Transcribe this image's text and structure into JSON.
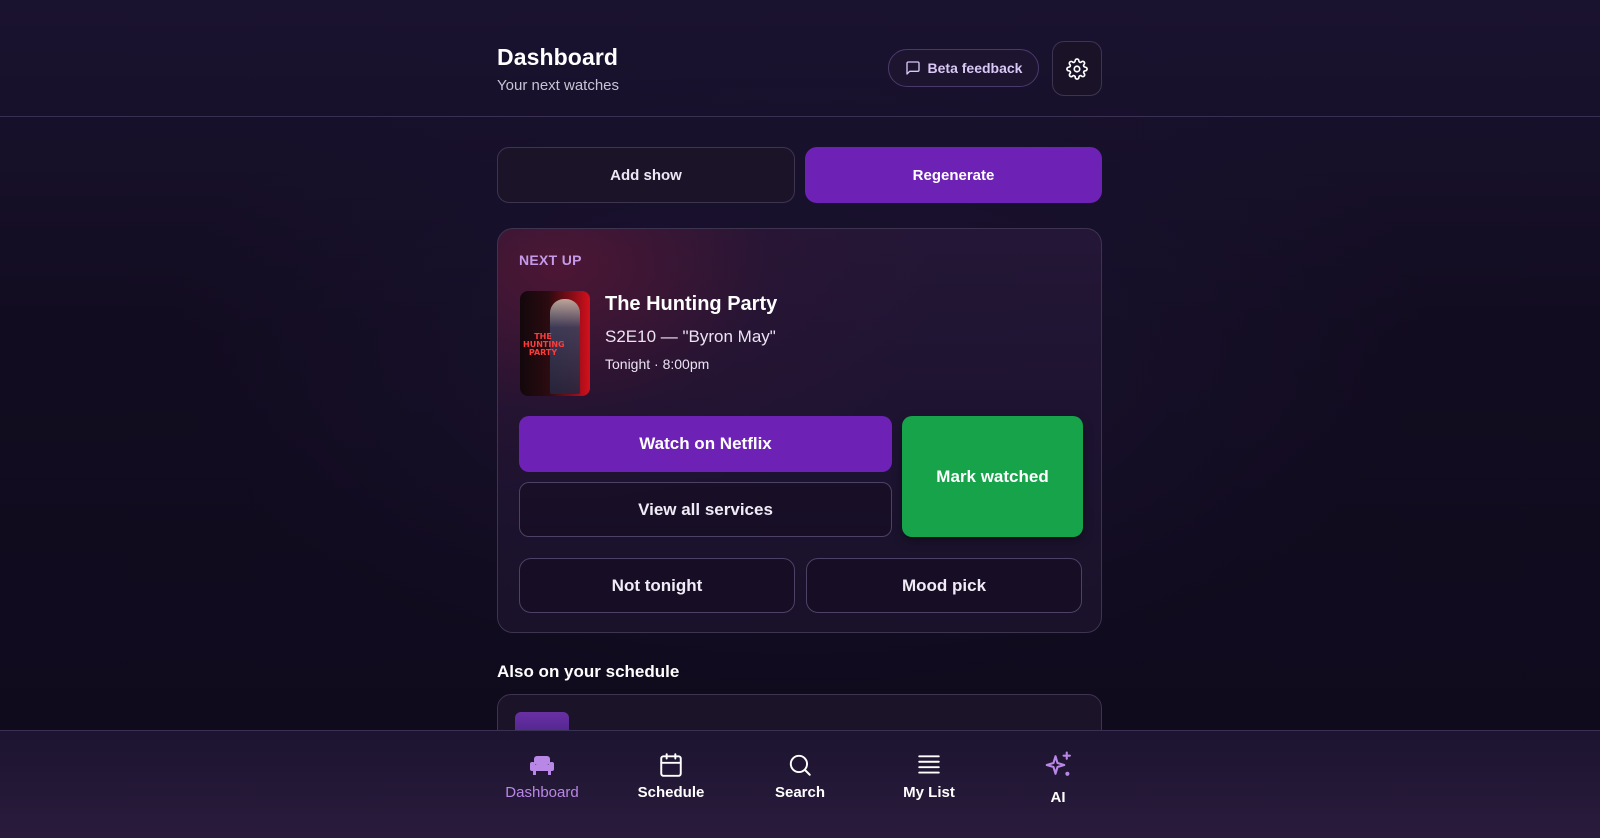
{
  "header": {
    "title": "Dashboard",
    "subtitle": "Your next watches",
    "beta_feedback_label": "Beta feedback",
    "settings_icon": "gear-icon",
    "feedback_icon": "message-square-icon"
  },
  "top_actions": {
    "add_show_label": "Add show",
    "regenerate_label": "Regenerate"
  },
  "next_up": {
    "section_label": "NEXT UP",
    "poster_text": "THE HUNTING PARTY",
    "show_title": "The Hunting Party",
    "episode": "S2E10 — \"Byron May\"",
    "airtime": "Tonight · 8:00pm",
    "watch_label": "Watch on Netflix",
    "services_label": "View all services",
    "mark_watched_label": "Mark watched",
    "not_tonight_label": "Not tonight",
    "mood_pick_label": "Mood pick"
  },
  "also_on_schedule": {
    "heading": "Also on your schedule"
  },
  "bottom_nav": {
    "items": [
      {
        "label": "Dashboard",
        "icon": "couch-icon",
        "active": true
      },
      {
        "label": "Schedule",
        "icon": "calendar-icon",
        "active": false
      },
      {
        "label": "Search",
        "icon": "search-icon",
        "active": false
      },
      {
        "label": "My List",
        "icon": "list-icon",
        "active": false
      },
      {
        "label": "AI",
        "icon": "sparkles-icon",
        "active": false
      }
    ]
  },
  "colors": {
    "accent_purple": "#6d22b5",
    "success_green": "#16a34a",
    "label_purple": "#c49ae8",
    "background": "#130d22"
  }
}
